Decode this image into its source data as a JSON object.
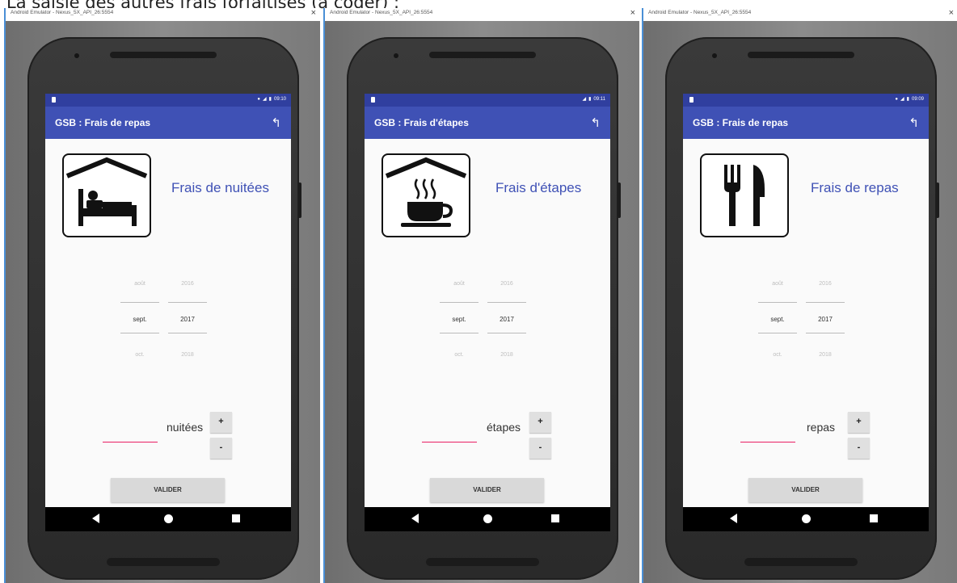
{
  "page_heading": "La saisie des autres frais forfaitisés (à coder) :",
  "screens": [
    {
      "window_title": "Android Emulator - Nexus_5X_API_26:5554",
      "clock": "09:10",
      "app_title": "GSB : Frais de repas",
      "category_icon": "bed-icon",
      "category_label": "Frais de nuitées",
      "picker": {
        "month_prev": "août",
        "year_prev": "2016",
        "month_sel": "sept.",
        "year_sel": "2017",
        "month_next": "oct.",
        "year_next": "2018"
      },
      "quantity_unit": "nuitées",
      "plus_label": "+",
      "minus_label": "-",
      "validate_label": "VALIDER"
    },
    {
      "window_title": "Android Emulator - Nexus_5X_API_26:5554",
      "clock": "09:11",
      "app_title": "GSB : Frais d'étapes",
      "category_icon": "coffee-cup-icon",
      "category_label": "Frais d'étapes",
      "picker": {
        "month_prev": "août",
        "year_prev": "2016",
        "month_sel": "sept.",
        "year_sel": "2017",
        "month_next": "oct.",
        "year_next": "2018"
      },
      "quantity_unit": "étapes",
      "plus_label": "+",
      "minus_label": "-",
      "validate_label": "VALIDER"
    },
    {
      "window_title": "Android Emulator - Nexus_5X_API_26:5554",
      "clock": "09:09",
      "app_title": "GSB : Frais de repas",
      "category_icon": "fork-knife-icon",
      "category_label": "Frais de repas",
      "picker": {
        "month_prev": "août",
        "year_prev": "2016",
        "month_sel": "sept.",
        "year_sel": "2017",
        "month_next": "oct.",
        "year_next": "2018"
      },
      "quantity_unit": "repas",
      "plus_label": "+",
      "minus_label": "-",
      "validate_label": "VALIDER"
    }
  ],
  "colors": {
    "status_bar": "#303f9f",
    "app_bar": "#3f51b5",
    "accent_text": "#3f51b5",
    "field_underline": "#e91e63",
    "window_border": "#4a8fd6"
  }
}
